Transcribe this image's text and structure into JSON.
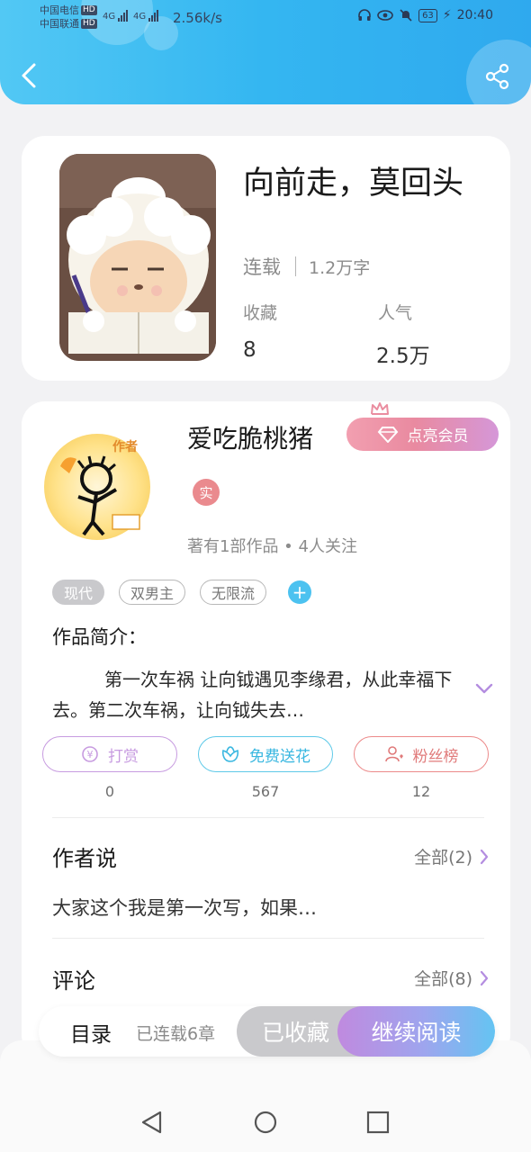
{
  "status_bar": {
    "carrier1": "中国电信",
    "carrier2": "中国联通",
    "hd": "HD",
    "net1": "4G",
    "net2": "4G",
    "net_speed": "2.56k/s",
    "battery": "63",
    "time": "20:40"
  },
  "book": {
    "title": "向前走，莫回头",
    "status": "连载",
    "word_count": "1.2万字",
    "favorites_label": "收藏",
    "favorites_value": "8",
    "popularity_label": "人气",
    "popularity_value": "2.5万"
  },
  "author": {
    "name": "爱吃脆桃猪",
    "badge_text": "作者",
    "vip_label": "点亮会员",
    "real_badge": "实",
    "works_info": "著有1部作品 • 4人关注"
  },
  "tags": [
    "现代",
    "双男主",
    "无限流"
  ],
  "tag_add": "+",
  "intro": {
    "label": "作品简介：",
    "text": "第一次车祸 让向钺遇见李缘君，从此幸福下去。第二次车祸，让向钺失去…"
  },
  "actions": [
    {
      "label": "打赏",
      "count": "0",
      "color": "#c79be0",
      "icon": "yen-coin-icon"
    },
    {
      "label": "免费送花",
      "count": "567",
      "color": "#5ec9e8",
      "icon": "flower-icon"
    },
    {
      "label": "粉丝榜",
      "count": "12",
      "color": "#ec8a8a",
      "icon": "fan-user-icon"
    }
  ],
  "author_says": {
    "title": "作者说",
    "more": "全部(2)",
    "text": "大家这个我是第一次写，如果…"
  },
  "comments": {
    "title": "评论",
    "more": "全部(8)"
  },
  "bottom_bar": {
    "toc_label": "目录",
    "toc_sub": "已连载6章",
    "favorited": "已收藏",
    "continue_read": "继续阅读"
  },
  "colors": {
    "header": "#34b6f1",
    "accent_blue": "#4cc2f0",
    "vip_pink": "#e98aa0"
  }
}
